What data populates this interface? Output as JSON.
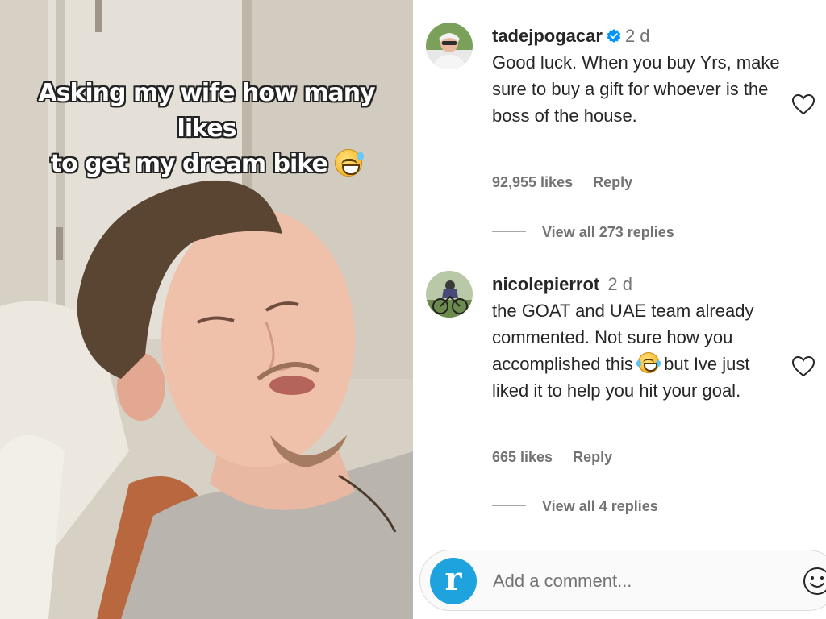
{
  "video": {
    "caption_line1": "Asking my wife how many likes",
    "caption_line2": "to get my dream bike",
    "caption_emoji": "grinning-face-with-sweat"
  },
  "comments": [
    {
      "username": "tadejpogacar",
      "verified": true,
      "time": "2 d",
      "text": "Good luck. When you buy Yrs, make sure to buy a gift for whoever is the boss of the house.",
      "likes": "92,955 likes",
      "reply_label": "Reply",
      "view_replies": "View all 273 replies"
    },
    {
      "username": "nicolepierrot",
      "verified": false,
      "time": "2 d",
      "text_before_emoji": "the GOAT and UAE team already commented. Not sure how you accomplished this",
      "text_emoji": "face-with-tears-of-joy",
      "text_after_emoji": "but Ive just liked it to help you hit your goal.",
      "likes": "665 likes",
      "reply_label": "Reply",
      "view_replies": "View all 4 replies"
    }
  ],
  "add_comment": {
    "placeholder": "Add a comment...",
    "brand_letter": "r"
  },
  "colors": {
    "verified_blue": "#0095f6",
    "brand_blue": "#1fa3df",
    "muted_text": "#737373"
  }
}
